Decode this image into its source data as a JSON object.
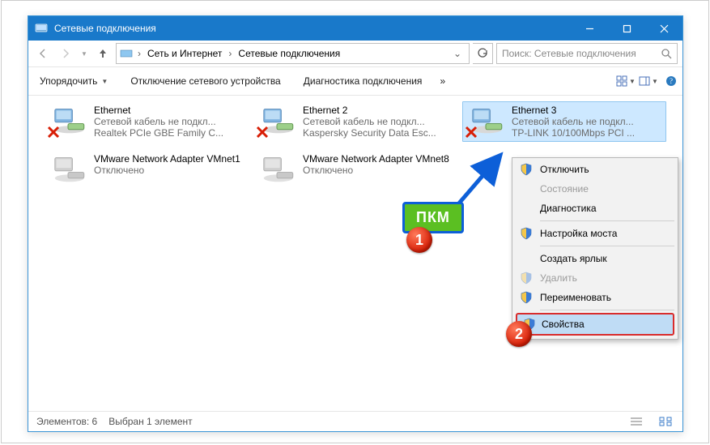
{
  "titlebar": {
    "title": "Сетевые подключения"
  },
  "breadcrumbs": {
    "seg1": "Сеть и Интернет",
    "seg2": "Сетевые подключения"
  },
  "search": {
    "placeholder": "Поиск: Сетевые подключения"
  },
  "toolbar": {
    "organize": "Упорядочить",
    "disable": "Отключение сетевого устройства",
    "diagnose": "Диагностика подключения"
  },
  "items": [
    {
      "name": "Ethernet",
      "status": "Сетевой кабель не подкл...",
      "device": "Realtek PCIe GBE Family C..."
    },
    {
      "name": "Ethernet 2",
      "status": "Сетевой кабель не подкл...",
      "device": "Kaspersky Security Data Esc..."
    },
    {
      "name": "Ethernet 3",
      "status": "Сетевой кабель не подкл...",
      "device": "TP-LINK 10/100Mbps PCI ..."
    },
    {
      "name": "VMware Network Adapter VMnet1",
      "status": "Отключено",
      "device": ""
    },
    {
      "name": "VMware Network Adapter VMnet8",
      "status": "Отключено",
      "device": ""
    }
  ],
  "statusbar": {
    "count": "Элементов: 6",
    "selected": "Выбран 1 элемент"
  },
  "context_menu": {
    "disable": "Отключить",
    "status": "Состояние",
    "diagnose": "Диагностика",
    "bridge": "Настройка моста",
    "shortcut": "Создать ярлык",
    "delete": "Удалить",
    "rename": "Переименовать",
    "properties": "Свойства"
  },
  "callout": {
    "hint": "ПКМ",
    "badge1": "1",
    "badge2": "2"
  }
}
